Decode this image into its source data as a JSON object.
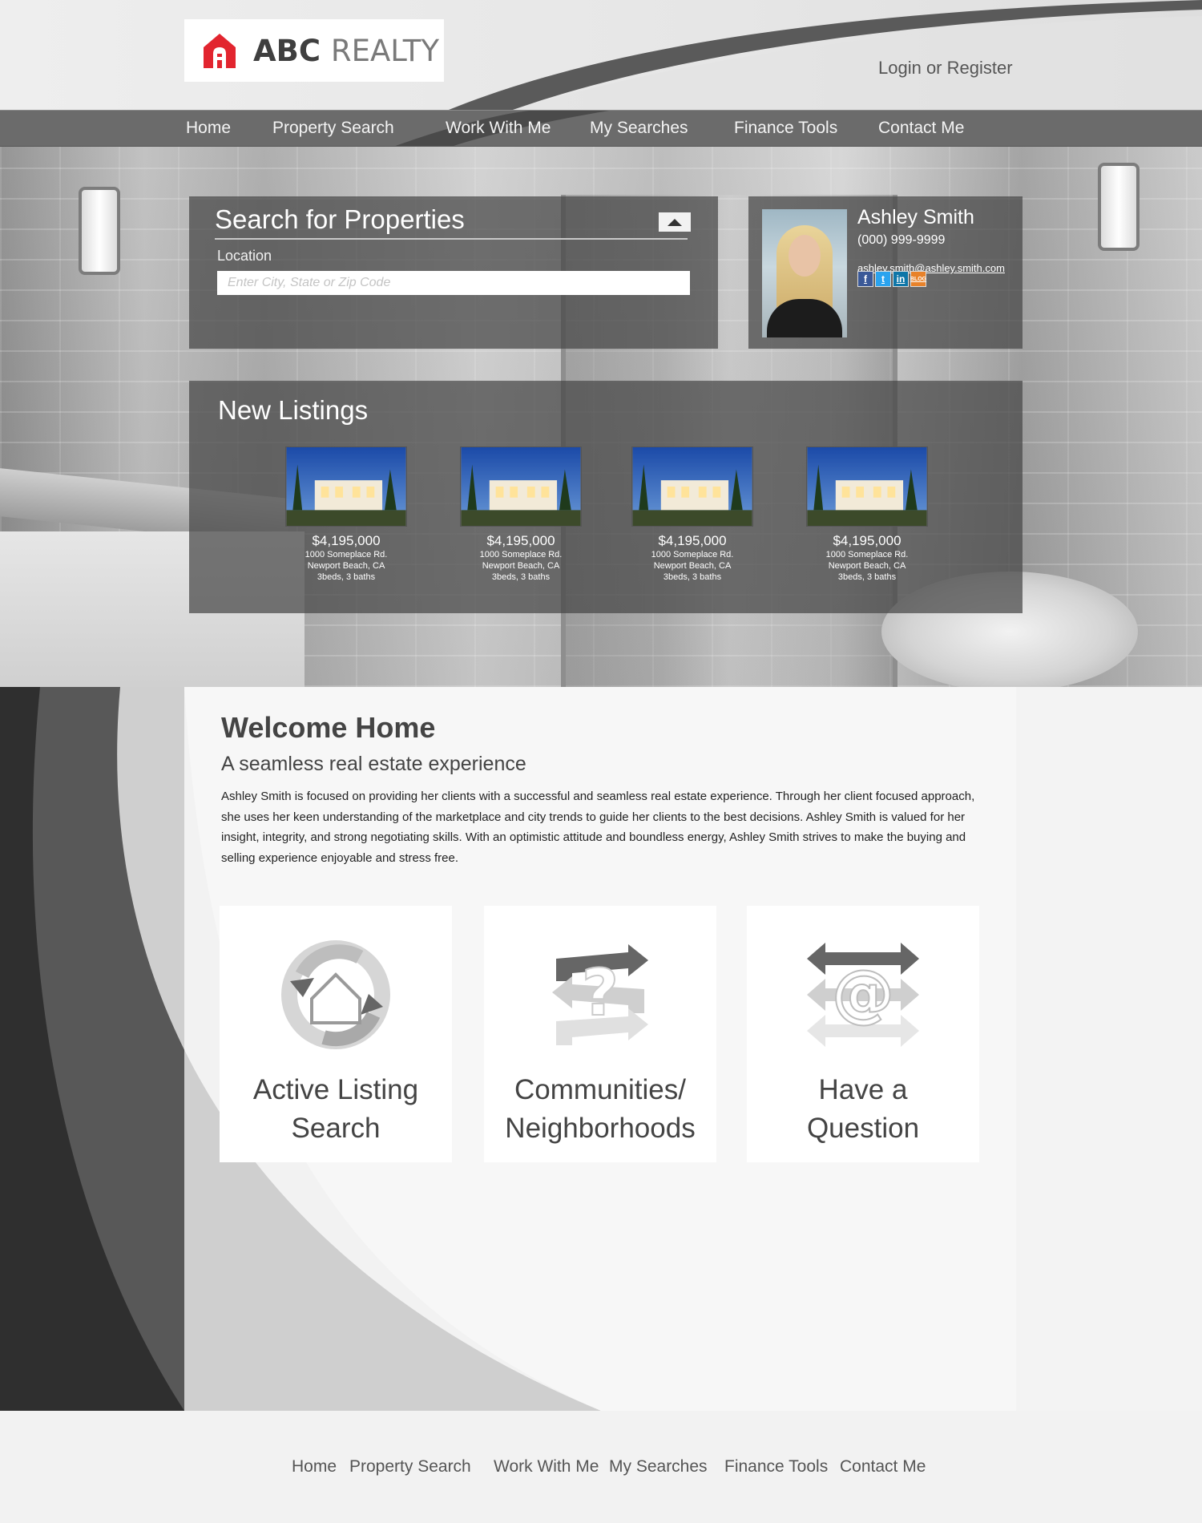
{
  "brand": {
    "name_primary": "ABC",
    "name_secondary": "REALTY",
    "logo_color": "#e2252f"
  },
  "header": {
    "login_label": "Login or Register"
  },
  "nav": {
    "items": [
      {
        "label": "Home"
      },
      {
        "label": "Property Search"
      },
      {
        "label": "Work With Me"
      },
      {
        "label": "My Searches"
      },
      {
        "label": "Finance Tools"
      },
      {
        "label": "Contact Me"
      }
    ]
  },
  "search": {
    "title": "Search for Properties",
    "location_label": "Location",
    "location_placeholder": "Enter City, State or Zip Code",
    "location_value": "",
    "collapse_icon": "caret-up-icon"
  },
  "agent": {
    "name": "Ashley Smith",
    "phone": "(000) 999-9999",
    "email": "ashley.smith@ashley.smith.com",
    "social": [
      {
        "icon": "facebook-icon",
        "glyph": "f"
      },
      {
        "icon": "twitter-icon",
        "glyph": "t"
      },
      {
        "icon": "linkedin-icon",
        "glyph": "in"
      },
      {
        "icon": "blog-icon",
        "glyph": "BLOG"
      }
    ]
  },
  "listings": {
    "title": "New Listings",
    "items": [
      {
        "price": "$4,195,000",
        "street": "1000 Someplace Rd.",
        "city": "Newport Beach, CA",
        "details": "3beds, 3 baths"
      },
      {
        "price": "$4,195,000",
        "street": "1000 Someplace Rd.",
        "city": "Newport Beach, CA",
        "details": "3beds, 3 baths"
      },
      {
        "price": "$4,195,000",
        "street": "1000 Someplace Rd.",
        "city": "Newport Beach, CA",
        "details": "3beds, 3 baths"
      },
      {
        "price": "$4,195,000",
        "street": "1000 Someplace Rd.",
        "city": "Newport Beach, CA",
        "details": "3beds, 3 baths"
      }
    ]
  },
  "welcome": {
    "title": "Welcome Home",
    "subtitle": "A seamless real estate experience",
    "body": "Ashley Smith is focused on providing her clients with a successful and seamless real estate experience. Through her client focused approach, she uses her keen understanding of the marketplace and city trends to guide her clients to the best decisions. Ashley Smith is valued for her insight, integrity, and strong negotiating skills. With an optimistic attitude and boundless energy, Ashley Smith strives to make the buying and selling experience enjoyable and stress free."
  },
  "features": [
    {
      "label_line1": "Active Listing",
      "label_line2": "Search",
      "icon": "house-cycle-icon"
    },
    {
      "label_line1": "Communities/",
      "label_line2": "Neighborhoods",
      "icon": "question-arrows-icon"
    },
    {
      "label_line1": "Have a",
      "label_line2": "Question",
      "icon": "at-arrows-icon"
    }
  ],
  "footer": {
    "items": [
      {
        "label": "Home"
      },
      {
        "label": "Property Search"
      },
      {
        "label": "Work With Me"
      },
      {
        "label": "My Searches"
      },
      {
        "label": "Finance Tools"
      },
      {
        "label": "Contact Me"
      }
    ]
  },
  "colors": {
    "nav_bg": "#6b6b6b",
    "panel_bg": "rgba(70,70,70,0.72)",
    "text_dark": "#444444"
  }
}
